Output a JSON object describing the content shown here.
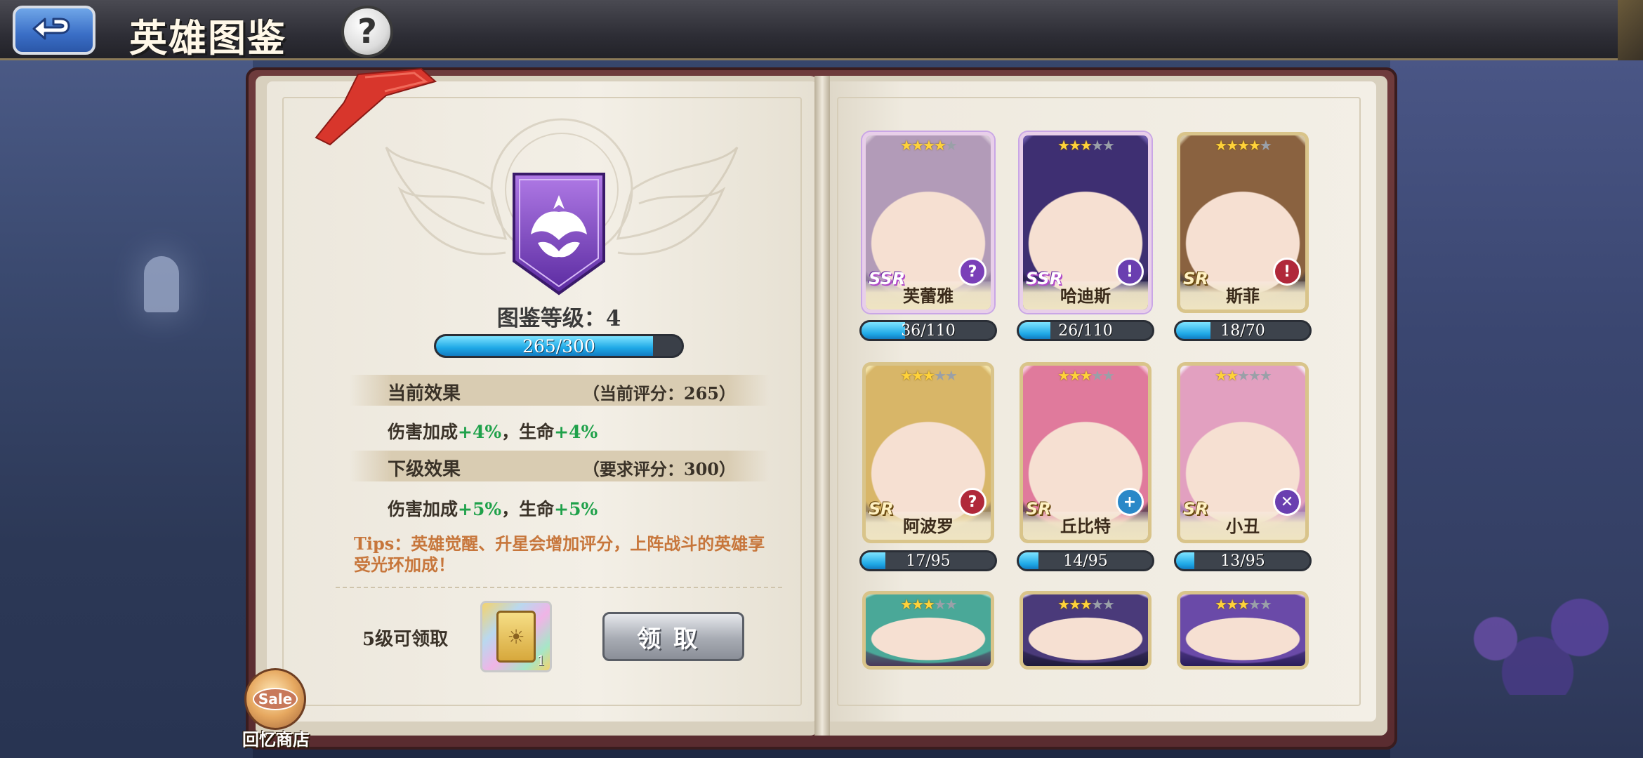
{
  "header": {
    "title": "英雄图鉴",
    "help_symbol": "?"
  },
  "collection": {
    "level_label": "图鉴等级：4",
    "xp_progress": 0.883,
    "xp_text": "265/300",
    "current_effect": {
      "title": "当前效果",
      "score": "（当前评分：265）",
      "line_prefix": "伤害加成",
      "line_value1": "+4%",
      "line_mid": "，生命",
      "line_value2": "+4%"
    },
    "next_effect": {
      "title": "下级效果",
      "score": "（要求评分：300）",
      "line_prefix": "伤害加成",
      "line_value1": "+5%",
      "line_mid": "，生命",
      "line_value2": "+5%"
    },
    "tips": "Tips：英雄觉醒、升星会增加评分，上阵战斗的英雄享受光环加成！",
    "reward": {
      "label": "5级可领取",
      "count": "1",
      "claim_label": "领取"
    }
  },
  "heroes": [
    {
      "name": "芙蕾雅",
      "rarity": "SSR",
      "stars": 4,
      "progress_text": "36/110",
      "progress": 0.327,
      "class_color": "#7a3fb8",
      "class_icon": "?",
      "portrait_colors": [
        "#d8c8d8",
        "#b29bb8",
        "#7a6a8a"
      ]
    },
    {
      "name": "哈迪斯",
      "rarity": "SSR",
      "stars": 3,
      "progress_text": "26/110",
      "progress": 0.236,
      "class_color": "#6a3fb0",
      "class_icon": "!",
      "portrait_colors": [
        "#6a58a8",
        "#3e2f72",
        "#1e1a3a"
      ]
    },
    {
      "name": "斯菲",
      "rarity": "SR",
      "stars": 4,
      "progress_text": "18/70",
      "progress": 0.257,
      "class_color": "#b0283a",
      "class_icon": "!",
      "portrait_colors": [
        "#d6c6a4",
        "#8a6240",
        "#3a3a42"
      ]
    },
    {
      "name": "阿波罗",
      "rarity": "SR",
      "stars": 3,
      "progress_text": "17/95",
      "progress": 0.179,
      "class_color": "#b0283a",
      "class_icon": "?",
      "portrait_colors": [
        "#f2e2a8",
        "#d8b668",
        "#7a6a5a"
      ]
    },
    {
      "name": "丘比特",
      "rarity": "SR",
      "stars": 3,
      "progress_text": "14/95",
      "progress": 0.147,
      "class_color": "#2a88c8",
      "class_icon": "+",
      "portrait_colors": [
        "#f6c6d6",
        "#e07a9c",
        "#2a2a36"
      ]
    },
    {
      "name": "小丑",
      "rarity": "SR",
      "stars": 2,
      "progress_text": "13/95",
      "progress": 0.137,
      "class_color": "#6a3fb0",
      "class_icon": "✕",
      "portrait_colors": [
        "#f4e6f0",
        "#e2a0c0",
        "#8a6aa8"
      ]
    },
    {
      "name": "",
      "rarity": "",
      "stars": 3,
      "progress_text": "",
      "progress": 0,
      "class_color": "",
      "class_icon": "",
      "portrait_colors": [
        "#a8d8c8",
        "#4aa898",
        "#4a3a5a"
      ]
    },
    {
      "name": "",
      "rarity": "",
      "stars": 3,
      "progress_text": "",
      "progress": 0,
      "class_color": "",
      "class_icon": "",
      "portrait_colors": [
        "#c8c0e8",
        "#4a3a7a",
        "#1e1a3a"
      ]
    },
    {
      "name": "",
      "rarity": "",
      "stars": 3,
      "progress_text": "",
      "progress": 0,
      "class_color": "",
      "class_icon": "",
      "portrait_colors": [
        "#d8b8e8",
        "#6a4aa8",
        "#2a1e5a"
      ]
    }
  ],
  "shop": {
    "badge": "Sale",
    "label": "回忆商店"
  }
}
